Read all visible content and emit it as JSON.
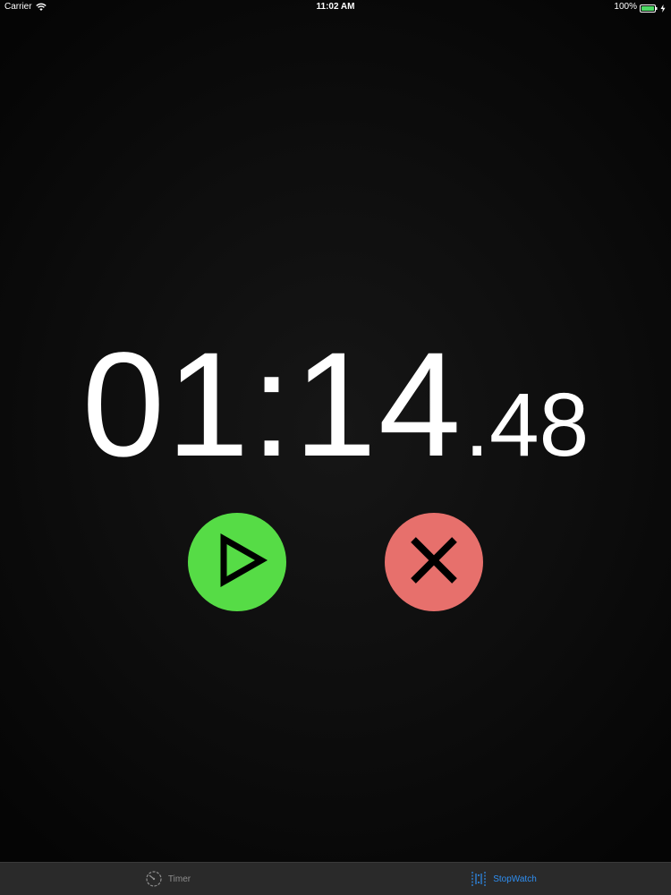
{
  "status_bar": {
    "carrier": "Carrier",
    "time": "11:02 AM",
    "battery": "100%"
  },
  "stopwatch": {
    "main": "01:14",
    "dot": ".",
    "fraction": "48"
  },
  "buttons": {
    "play": {
      "icon": "play-icon",
      "color": "#56dc46"
    },
    "cancel": {
      "icon": "close-icon",
      "color": "#e7706c"
    }
  },
  "tabs": [
    {
      "label": "Timer",
      "icon": "timer-icon",
      "active": false
    },
    {
      "label": "StopWatch",
      "icon": "stopwatch-icon",
      "active": true
    }
  ],
  "colors": {
    "active_tab": "#2f8ff2",
    "inactive_tab": "#8e8e8e"
  }
}
